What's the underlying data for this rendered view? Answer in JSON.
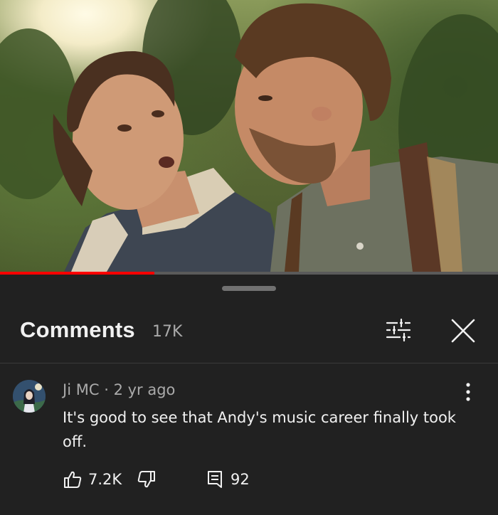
{
  "video": {
    "progress": 0.31
  },
  "comments_panel": {
    "title": "Comments",
    "count": "17K",
    "filter_icon": "sliders-icon",
    "close_icon": "close-icon"
  },
  "comment": {
    "author": "Ji MC",
    "separator": "·",
    "age": "2 yr ago",
    "text": "It's good to see that Andy's music career finally took off.",
    "likes": "7.2K",
    "replies": "92",
    "like_icon": "thumbs-up-icon",
    "dislike_icon": "thumbs-down-icon",
    "reply_icon": "reply-icon",
    "more_icon": "more-vert-icon"
  },
  "colors": {
    "background": "#212121",
    "progress_played": "#ff0000",
    "secondary_text": "#aaaaaa"
  }
}
